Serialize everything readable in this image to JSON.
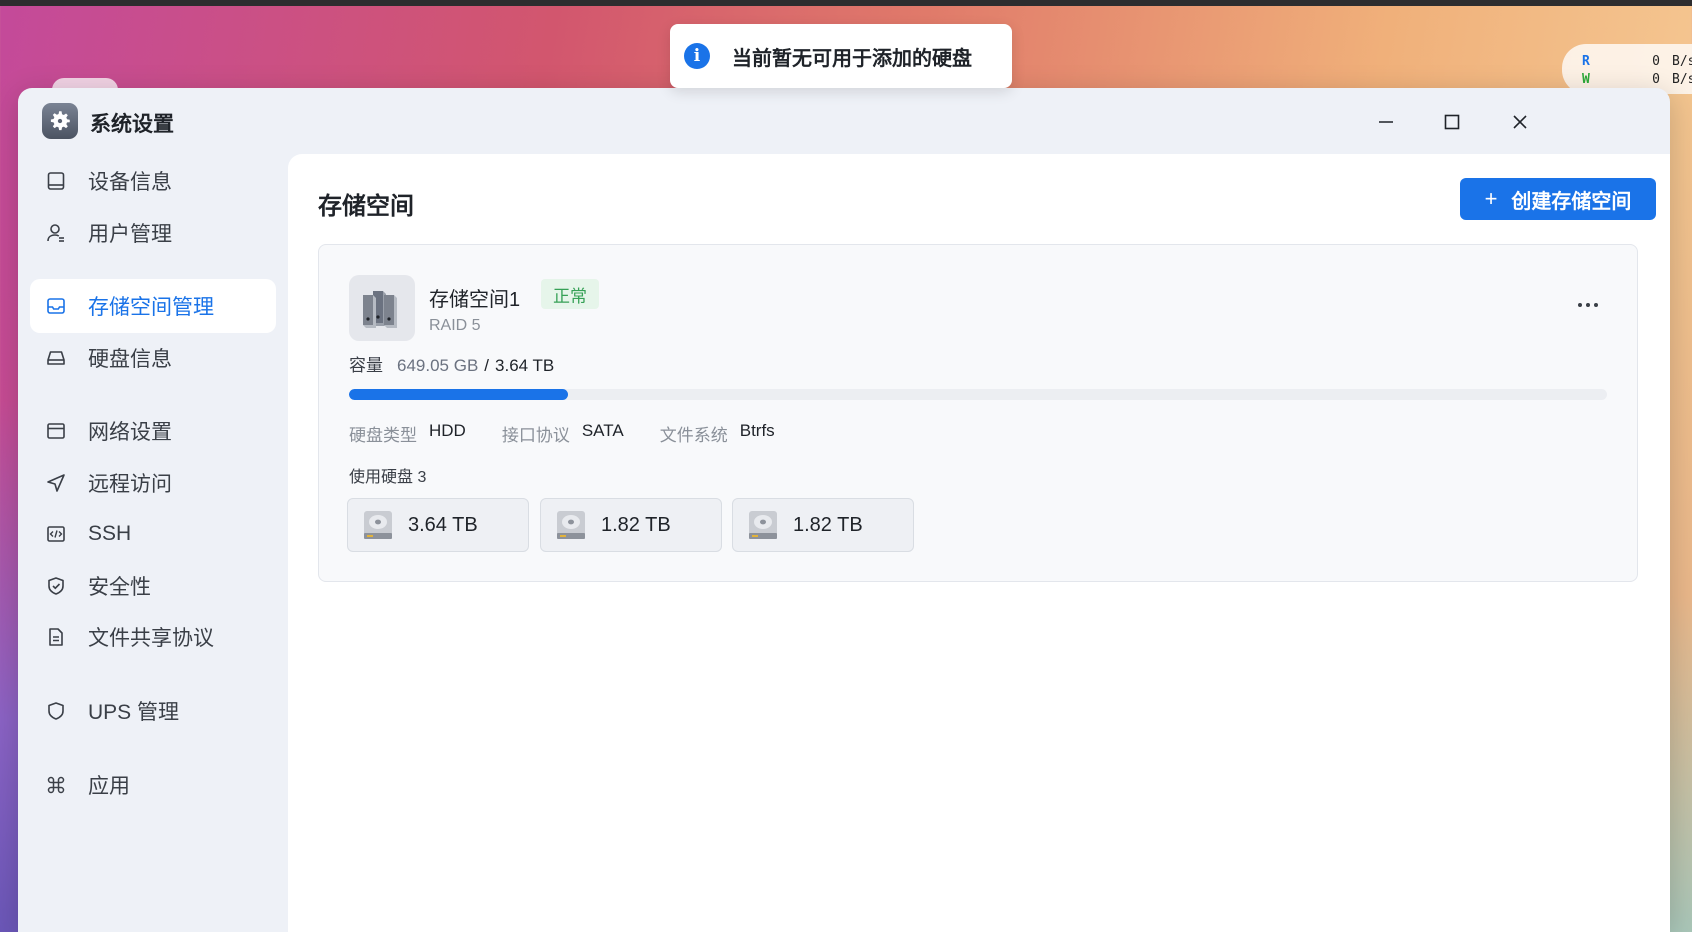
{
  "toast": {
    "message": "当前暂无可用于添加的硬盘",
    "icon": "info-icon"
  },
  "speed": {
    "read_label": "R",
    "read_value": "0",
    "read_unit": "B/s",
    "write_label": "W",
    "write_value": "0",
    "write_unit": "B/s"
  },
  "window": {
    "title": "系统设置",
    "icon": "gear-icon"
  },
  "sidebar": {
    "items": [
      {
        "label": "设备信息",
        "icon": "device-icon"
      },
      {
        "label": "用户管理",
        "icon": "user-icon"
      },
      {
        "label": "存储空间管理",
        "icon": "storage-icon",
        "active": true
      },
      {
        "label": "硬盘信息",
        "icon": "harddisk-icon"
      },
      {
        "label": "网络设置",
        "icon": "network-icon"
      },
      {
        "label": "远程访问",
        "icon": "send-icon"
      },
      {
        "label": "SSH",
        "icon": "code-icon"
      },
      {
        "label": "安全性",
        "icon": "shield-check-icon"
      },
      {
        "label": "文件共享协议",
        "icon": "document-icon"
      },
      {
        "label": "UPS 管理",
        "icon": "shield-icon"
      },
      {
        "label": "应用",
        "icon": "command-icon"
      }
    ]
  },
  "main": {
    "title": "存储空间",
    "create_button": "创建存储空间",
    "pool": {
      "name": "存储空间1",
      "status": "正常",
      "raid": "RAID 5",
      "capacity_label": "容量",
      "used": "649.05 GB",
      "separator": "/",
      "total": "3.64 TB",
      "usage_fraction": 0.174,
      "disk_type_label": "硬盘类型",
      "disk_type": "HDD",
      "interface_label": "接口协议",
      "interface": "SATA",
      "filesystem_label": "文件系统",
      "filesystem": "Btrfs",
      "disks_used_label": "使用硬盘 3",
      "disks": [
        {
          "size": "3.64 TB"
        },
        {
          "size": "1.82 TB"
        },
        {
          "size": "1.82 TB"
        }
      ]
    }
  },
  "colors": {
    "accent": "#1a73e8",
    "status_ok": "#36a156",
    "status_ok_bg": "#e6f5ea"
  }
}
